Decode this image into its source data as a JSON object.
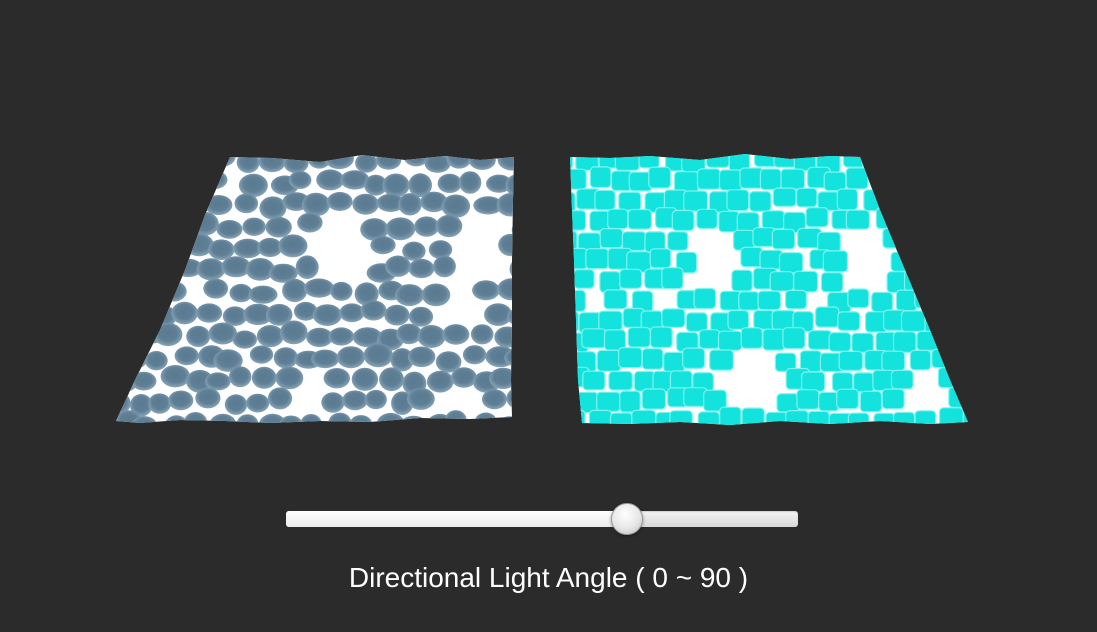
{
  "scene": {
    "background_color": "#2b2b2b",
    "left_plane_color": "#5f7f96",
    "left_highlight_color": "#ffffff",
    "right_plane_color": "#13e3dc",
    "right_crack_color": "#7ff3ee",
    "right_highlight_color": "#ffffff"
  },
  "slider": {
    "value": 60,
    "min": 0,
    "max": 90
  },
  "caption": {
    "text": "Directional Light Angle ( 0 ~ 90 )"
  }
}
